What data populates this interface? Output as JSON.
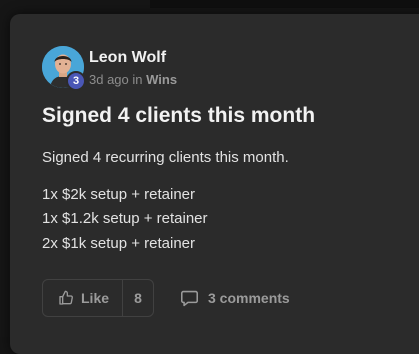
{
  "post": {
    "author": "Leon Wolf",
    "level": "3",
    "time_ago": "3d ago",
    "in_text": "in",
    "category": "Wins",
    "title": "Signed 4 clients this month",
    "body": [
      "Signed 4 recurring clients this month.",
      "1x $2k setup + retainer",
      "1x $1.2k setup + retainer",
      "2x $1k setup + retainer"
    ]
  },
  "actions": {
    "like_label": "Like",
    "like_count": "8",
    "comments_label": "3 comments"
  },
  "icons": {
    "like": "thumbs-up-icon",
    "comments": "comment-bubble-icon"
  },
  "colors": {
    "card_bg": "#2b2b2b",
    "level_badge": "#4a57b6",
    "avatar_bg": "#49a6d8"
  }
}
